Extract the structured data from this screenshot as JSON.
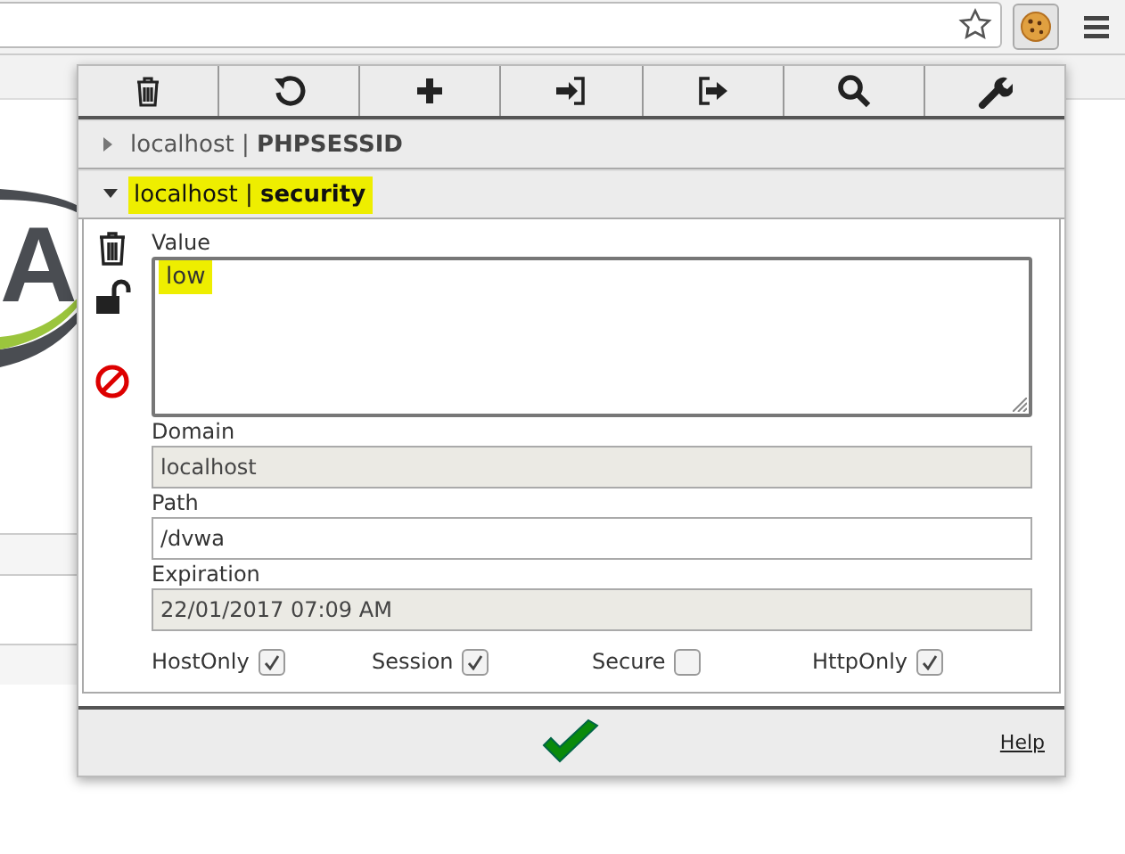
{
  "page": {
    "logo_text": "A"
  },
  "cookies": [
    {
      "domain": "localhost",
      "separator": "|",
      "name": "PHPSESSID",
      "expanded": false,
      "matched": false
    },
    {
      "domain": "localhost",
      "separator": "|",
      "name": "security",
      "expanded": true,
      "matched": true
    }
  ],
  "editor": {
    "value": {
      "label": "Value",
      "value": "low",
      "matched": true
    },
    "fields": [
      {
        "label": "Domain",
        "value": "localhost",
        "disabled": true
      },
      {
        "label": "Path",
        "value": "/dvwa",
        "disabled": false
      },
      {
        "label": "Expiration",
        "value": "22/01/2017 07:09 AM",
        "disabled": true
      }
    ],
    "flags": [
      {
        "label": "HostOnly",
        "checked": true
      },
      {
        "label": "Session",
        "checked": true
      },
      {
        "label": "Secure",
        "checked": false
      },
      {
        "label": "HttpOnly",
        "checked": true
      }
    ]
  },
  "footer": {
    "help": "Help"
  }
}
